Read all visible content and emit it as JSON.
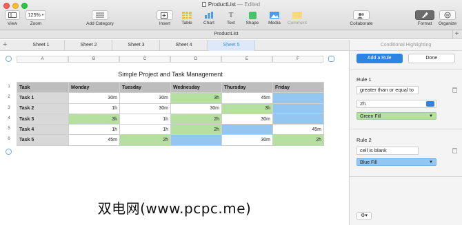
{
  "window": {
    "title": "ProductList",
    "status": "— Edited"
  },
  "toolbar": {
    "view": "View",
    "zoom_value": "125%",
    "zoom": "Zoom",
    "add_category": "Add Category",
    "insert": "Insert",
    "table": "Table",
    "chart": "Chart",
    "text": "Text",
    "shape": "Shape",
    "media": "Media",
    "comment": "Comment",
    "collaborate": "Collaborate",
    "format": "Format",
    "organize": "Organize"
  },
  "doc_bar": {
    "name": "ProductList"
  },
  "sheets": [
    "Sheet 1",
    "Sheet 2",
    "Sheet 3",
    "Sheet 4",
    "Sheet 5"
  ],
  "active_sheet": "Sheet 5",
  "columns": [
    "A",
    "B",
    "C",
    "D",
    "E",
    "F"
  ],
  "table": {
    "title": "Simple Project and Task Management",
    "headers": [
      "Task",
      "Monday",
      "Tuesday",
      "Wednesday",
      "Thursday",
      "Friday"
    ],
    "rows": [
      {
        "task": "Task 1",
        "cells": [
          "30m",
          "30m",
          "3h",
          "45m",
          ""
        ]
      },
      {
        "task": "Task 2",
        "cells": [
          "1h",
          "30m",
          "30m",
          "3h",
          ""
        ]
      },
      {
        "task": "Task 3",
        "cells": [
          "3h",
          "1h",
          "2h",
          "30m",
          ""
        ]
      },
      {
        "task": "Task 4",
        "cells": [
          "1h",
          "1h",
          "2h",
          "",
          "45m"
        ]
      },
      {
        "task": "Task 5",
        "cells": [
          "45m",
          "2h",
          "",
          "30m",
          "2h"
        ]
      }
    ],
    "row_numbers": [
      "1",
      "2",
      "3",
      "4",
      "5",
      "6"
    ]
  },
  "sidebar": {
    "title": "Conditional Highlighting",
    "add_rule": "Add a Rule",
    "done": "Done",
    "rule1": {
      "label": "Rule 1",
      "condition": "greater than or equal to",
      "value": "2h",
      "style": "Green Fill"
    },
    "rule2": {
      "label": "Rule 2",
      "condition": "cell is blank",
      "style": "Blue Fill"
    }
  },
  "colors": {
    "green_fill": "#b5e0a0",
    "blue_fill": "#93c7f2",
    "accent": "#2d84e3"
  },
  "watermark": "双电网(www.pcpc.me)"
}
